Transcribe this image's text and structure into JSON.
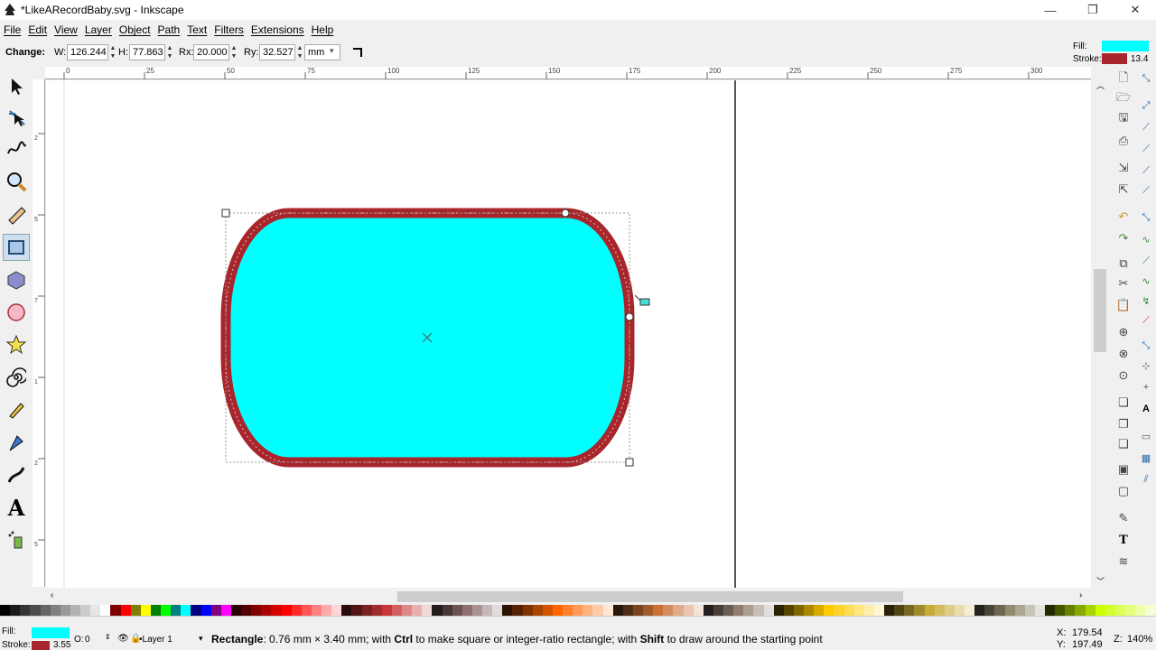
{
  "window": {
    "title": "*LikeARecordBaby.svg - Inkscape",
    "minimize": "—",
    "restore": "❐",
    "close": "✕"
  },
  "menu": [
    "File",
    "Edit",
    "View",
    "Layer",
    "Object",
    "Path",
    "Text",
    "Filters",
    "Extensions",
    "Help"
  ],
  "controls": {
    "change_label": "Change:",
    "w_label": "W:",
    "w_value": "126.244",
    "h_label": "H:",
    "h_value": "77.863",
    "rx_label": "Rx:",
    "rx_value": "20.000",
    "ry_label": "Ry:",
    "ry_value": "32.527",
    "unit": "mm"
  },
  "style_indicator": {
    "fill_label": "Fill:",
    "stroke_label": "Stroke:",
    "stroke_width": "13.4",
    "fill_color": "#00ffff",
    "stroke_color": "#a8262b"
  },
  "ruler_top": [
    "0",
    "25",
    "50",
    "75",
    "100",
    "125",
    "150",
    "175",
    "200",
    "225",
    "250",
    "275",
    "300"
  ],
  "ruler_left": [
    "2",
    "5",
    "7",
    "1",
    "2",
    "5",
    "1",
    "5",
    "0",
    "1",
    "2",
    "5"
  ],
  "tools": [
    "selector-tool",
    "node-tool",
    "tweak-tool",
    "zoom-tool",
    "measure-tool",
    "rect-tool",
    "3dbox-tool",
    "ellipse-tool",
    "star-tool",
    "spiral-tool",
    "pencil-tool",
    "pen-tool",
    "calligraphy-tool",
    "text-tool",
    "spray-tool"
  ],
  "canvas": {
    "shape_fill": "#00ffff",
    "shape_stroke": "#a8262b"
  },
  "status": {
    "fill_label": "Fill:",
    "stroke_label": "Stroke:",
    "stroke_width": "3.55",
    "opacity_label": "O:",
    "opacity_value": "0",
    "layer": "•Layer 1",
    "message_bold": "Rectangle",
    "message_1": ": 0.76 mm × 3.40 mm; with ",
    "ctrl": "Ctrl",
    "message_2": " to make square or integer-ratio rectangle; with ",
    "shift": "Shift",
    "message_3": " to draw around the starting point",
    "x_label": "X:",
    "x_value": "179.54",
    "y_label": "Y:",
    "y_value": "197.49",
    "zoom_label": "Z:",
    "zoom_value": "140%"
  },
  "palette_colors": [
    "#000000",
    "#1a1a1a",
    "#333333",
    "#4d4d4d",
    "#666666",
    "#808080",
    "#999999",
    "#b3b3b3",
    "#cccccc",
    "#e6e6e6",
    "#ffffff",
    "#800000",
    "#ff0000",
    "#808000",
    "#ffff00",
    "#008000",
    "#00ff00",
    "#008080",
    "#00ffff",
    "#000080",
    "#0000ff",
    "#800080",
    "#ff00ff",
    "#2b0000",
    "#550000",
    "#800000",
    "#aa0000",
    "#d40000",
    "#ff0000",
    "#ff2a2a",
    "#ff5555",
    "#ff8080",
    "#ffaaaa",
    "#ffd5d5",
    "#280b0b",
    "#501616",
    "#782121",
    "#a02c2c",
    "#c83737",
    "#d35f5f",
    "#de8787",
    "#e9afaf",
    "#f4d7d7",
    "#241c1c",
    "#483737",
    "#6c5353",
    "#916f6f",
    "#ac9393",
    "#c8b7b7",
    "#e3dbdb",
    "#2b1100",
    "#552200",
    "#803300",
    "#aa4400",
    "#d45500",
    "#ff6600",
    "#ff7f2a",
    "#ff9955",
    "#ffb380",
    "#ffccaa",
    "#ffe6d5",
    "#28170b",
    "#502d16",
    "#784421",
    "#a05a2c",
    "#c87137",
    "#d38d5f",
    "#deaa87",
    "#e9c6af",
    "#f4e3d7",
    "#241f1c",
    "#483e37",
    "#6c5d53",
    "#917c6f",
    "#ac9d93",
    "#c8beb7",
    "#e3dedb",
    "#2b2200",
    "#554400",
    "#806600",
    "#aa8800",
    "#d4aa00",
    "#ffcc00",
    "#ffd42a",
    "#ffdd55",
    "#ffe680",
    "#ffeeaa",
    "#fff6d5",
    "#28220b",
    "#504416",
    "#786721",
    "#a0892c",
    "#c8ab37",
    "#d3bc5f",
    "#decd87",
    "#e9ddaf",
    "#f4eed7",
    "#24221c",
    "#484537",
    "#6c6753",
    "#918a6f",
    "#aca793",
    "#c8c4b7",
    "#e3e2db",
    "#222b00",
    "#445500",
    "#668000",
    "#88aa00",
    "#aad400",
    "#ccff00",
    "#d4ff2a",
    "#ddff55",
    "#e5ff80",
    "#eeffaa",
    "#f6ffd5"
  ]
}
